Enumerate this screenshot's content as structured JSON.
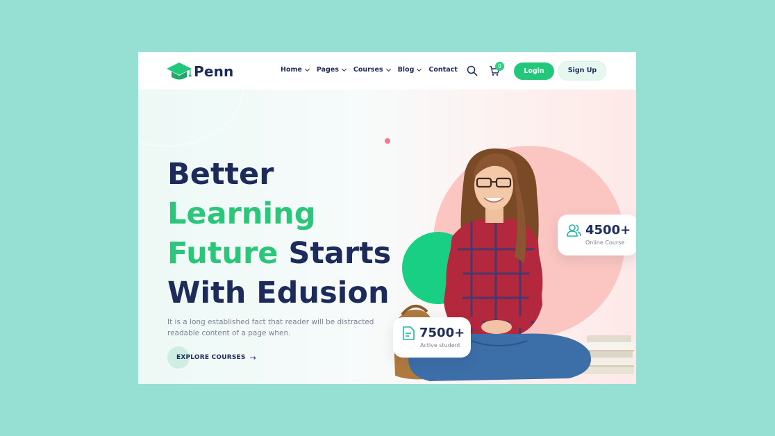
{
  "brand": {
    "name": "Penn"
  },
  "nav": {
    "items": [
      {
        "label": "Home",
        "has_dropdown": true
      },
      {
        "label": "Pages",
        "has_dropdown": true
      },
      {
        "label": "Courses",
        "has_dropdown": true
      },
      {
        "label": "Blog",
        "has_dropdown": true
      },
      {
        "label": "Contact",
        "has_dropdown": false
      }
    ],
    "cart_count": "0",
    "login_label": "Login",
    "signup_label": "Sign Up"
  },
  "hero": {
    "line1": "Better",
    "line2": "Learning",
    "line3_green": "Future",
    "line3_rest": " Starts",
    "line4": "With Edusion",
    "description": "It is a long established fact that reader will be distracted readable content of a page when.",
    "cta_label": "EXPLORE COURSES",
    "cta_arrow": "→"
  },
  "stats": {
    "online": {
      "value": "4500+",
      "label": "Online Course",
      "icon": "users-icon"
    },
    "students": {
      "value": "7500+",
      "label": "Active student",
      "icon": "document-icon"
    }
  },
  "colors": {
    "accent_green": "#22c77a",
    "navy": "#1c2b5a",
    "pink_circle": "#fbc6c1",
    "page_bg": "#95e0d3"
  }
}
